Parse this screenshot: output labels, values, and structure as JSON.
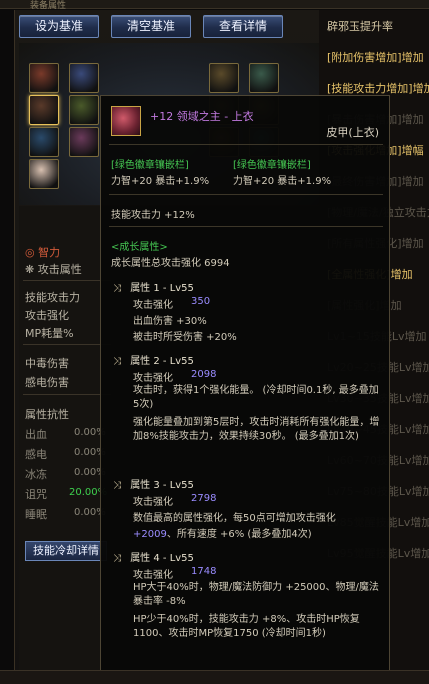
{
  "top_strip": {
    "tab": "装备属性"
  },
  "toolbar": {
    "set_base": "设为基准",
    "clear_base": "清空基准",
    "view_detail": "查看详情"
  },
  "equip_slots": [
    {
      "icon": "weapon-icon",
      "color": "#7a3a2a"
    },
    {
      "icon": "ring-icon",
      "color": "#3a4a7a"
    },
    {
      "icon": "armor-icon",
      "color": "#5a3a2a"
    },
    {
      "icon": "shoulder-icon",
      "color": "#4a5a2a"
    },
    {
      "icon": "belt-icon",
      "color": "#2a4a6a"
    },
    {
      "icon": "pants-icon",
      "color": "#5a4a2a"
    },
    {
      "icon": "shoes-icon",
      "color": "#3a5a4a"
    },
    {
      "icon": "earring-icon",
      "color": "#6a5a2a"
    },
    {
      "icon": "necklace-icon",
      "color": "#7a6a2a"
    },
    {
      "icon": "bracelet-icon",
      "color": "#6a4a1a"
    },
    {
      "icon": "gem-icon",
      "color": "#2a6a6a"
    },
    {
      "icon": "title-icon",
      "color": "#6a3a5a"
    },
    {
      "icon": "avatar-icon",
      "color": "#d8c0b0"
    }
  ],
  "stats": {
    "intelligence": "智力",
    "attack_attr": "攻击属性",
    "skill_attack": "技能攻击力",
    "attack_boost": "攻击强化",
    "mp_cost": "MP耗量%",
    "poison_dmg": "中毒伤害",
    "shock_dmg": "感电伤害",
    "elem_res": "属性抗性",
    "bleed": "出血",
    "bleed_v": "0.00%",
    "shock": "感电",
    "shock_v": "0.00%",
    "freeze": "冰冻",
    "freeze_v": "0.00%",
    "curse": "诅咒",
    "curse_v": "20.00%",
    "sleep": "睡眠",
    "sleep_v": "0.00%"
  },
  "cooldown_btn": "技能冷却详情",
  "right_list": [
    {
      "text": "辟邪玉提升率",
      "cls": ""
    },
    {
      "text": "[附加伤害增加]增加",
      "cls": "gold"
    },
    {
      "text": "[技能攻击力增加]增加",
      "cls": "gold"
    },
    {
      "text": "[暴击伤害增加]增加",
      "cls": "dim"
    },
    {
      "text": "[攻击强化增加]增幅",
      "cls": "gold"
    },
    {
      "text": "[最终伤害增加]增加",
      "cls": "dim"
    },
    {
      "text": "[物理/魔法/独立攻击力增",
      "cls": "dim"
    },
    {
      "text": "[所有属性强化]增加",
      "cls": "dim"
    },
    {
      "text": "[全属性强化]增加",
      "cls": "gold"
    },
    {
      "text": "[属性强化]增加",
      "cls": "dim"
    },
    {
      "text": "Lv1~15技能Lv增加",
      "cls": "dim"
    },
    {
      "text": "Lv20~25技能Lv增加",
      "cls": "dim"
    },
    {
      "text": "Lv30~35技能Lv增加",
      "cls": "dim"
    },
    {
      "text": "Lv40~45技能Lv增加",
      "cls": "dim"
    },
    {
      "text": "Lv60~70技能Lv增加",
      "cls": "dim"
    },
    {
      "text": "Lv75~80技能Lv增加",
      "cls": "dim"
    },
    {
      "text": "Lv85觉醒技能Lv增加",
      "cls": "dim"
    },
    {
      "text": "Lv95觉醒技能Lv增加",
      "cls": "dim"
    }
  ],
  "tooltip": {
    "title": "+12 领域之主 - 上衣",
    "subtype": "皮甲(上衣)",
    "socket_label_1": "[绿色徽章镶嵌栏]",
    "socket_label_2": "[绿色徽章镶嵌栏]",
    "socket_val_1": "力智+20 暴击+1.9%",
    "socket_val_2": "力智+20 暴击+1.9%",
    "skill_atk": "技能攻击力 +12%",
    "growth_head": "<成长属性>",
    "growth_total": "成长属性总攻击强化 6994",
    "attr1": {
      "head": "属性 1 - Lv55",
      "boost_lbl": "攻击强化",
      "boost": "350",
      "l1": "出血伤害 +30%",
      "l2": "被击时所受伤害 +20%"
    },
    "attr2": {
      "head": "属性 2 - Lv55",
      "boost_lbl": "攻击强化",
      "boost": "2098",
      "p1": "攻击时，获得1个强化能量。 (冷却时间0.1秒, 最多叠加5次)",
      "p2": "强化能量叠加到第5层时，攻击时消耗所有强化能量，增加8%技能攻击力，效果持续30秒。 (最多叠加1次)"
    },
    "attr3": {
      "head": "属性 3 - Lv55",
      "boost_lbl": "攻击强化",
      "boost": "2798",
      "p1": "数值最高的属性强化，每50点可增加攻击强化",
      "p1b": "+2009",
      "p1c": "、所有速度 +6% (最多叠加4次)"
    },
    "attr4": {
      "head": "属性 4 - Lv55",
      "boost_lbl": "攻击强化",
      "boost": "1748",
      "p1": "HP大于40%时，物理/魔法防御力 +25000、物理/魔法暴击率 -8%",
      "p2": "HP少于40%时，技能攻击力 +8%、攻击时HP恢复1100、攻击时MP恢复1750 (冷却时间1秒)"
    }
  }
}
